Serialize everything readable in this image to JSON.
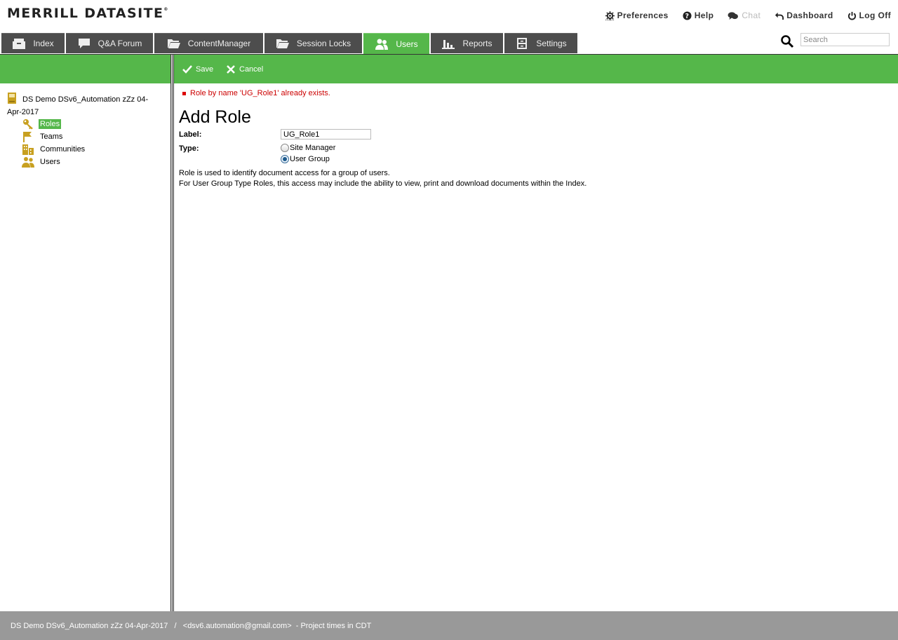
{
  "header": {
    "logo": "MERRILL DATASITE",
    "logo_mark": "®",
    "links": {
      "preferences": "Preferences",
      "help": "Help",
      "chat": "Chat",
      "dashboard": "Dashboard",
      "logoff": "Log Off"
    }
  },
  "tabs": {
    "index": "Index",
    "qa_forum": "Q&A Forum",
    "content_manager": "ContentManager",
    "session_locks": "Session Locks",
    "users": "Users",
    "reports": "Reports",
    "settings": "Settings",
    "active": "Users"
  },
  "search": {
    "placeholder": "Search"
  },
  "toolbar": {
    "save": "Save",
    "cancel": "Cancel"
  },
  "tree": {
    "root_label": "DS Demo DSv6_Automation zZz 04-Apr-2017",
    "items": [
      "Roles",
      "Teams",
      "Communities",
      "Users"
    ],
    "selected": "Roles"
  },
  "form": {
    "error": "Role by name 'UG_Role1' already exists.",
    "title": "Add Role",
    "label_field": "Label:",
    "label_value": "UG_Role1",
    "type_field": "Type:",
    "type_options": [
      "Site Manager",
      "User Group"
    ],
    "type_selected": "User Group",
    "description_line1": "Role is used to identify document access for a group of users.",
    "description_line2": "For User Group Type Roles, this access may include the ability to view, print and download documents within the Index."
  },
  "footer": {
    "text": "DS Demo DSv6_Automation zZz 04-Apr-2017   /   <dsv6.automation@gmail.com>  - Project times in CDT"
  },
  "colors": {
    "accent_green": "#55b74a",
    "tab_dark": "#4d4d4d",
    "error_red": "#cc0000",
    "footer_gray": "#999999",
    "icon_gold": "#c8a020"
  }
}
